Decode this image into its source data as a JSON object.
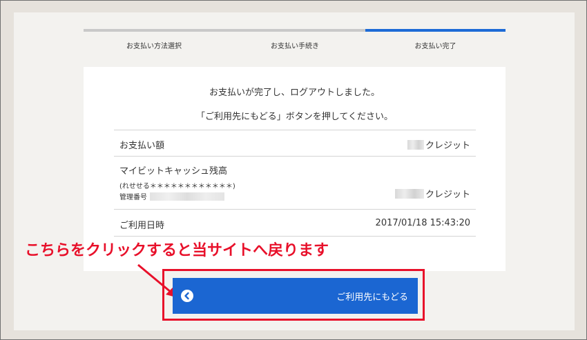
{
  "steps": [
    {
      "label": "お支払い方法選択",
      "active": false
    },
    {
      "label": "お支払い手続き",
      "active": false
    },
    {
      "label": "お支払い完了",
      "active": true
    }
  ],
  "message": {
    "line1": "お支払いが完了し、ログアウトしました。",
    "line2": "「ご利用先にもどる」ボタンを押してください。"
  },
  "payment": {
    "amount_label": "お支払い額",
    "amount_unit": "クレジット",
    "balance_label": "マイビットキャッシュ残高",
    "balance_sub": "(れせせる＊＊＊＊＊＊＊＊＊＊＊＊)",
    "management_label": "管理番号",
    "balance_unit": "クレジット",
    "date_label": "ご利用日時",
    "date_value": "2017/01/18 15:43:20"
  },
  "annotation": {
    "text": "こちらをクリックすると当サイトへ戻ります"
  },
  "return_button": {
    "label": "ご利用先にもどる"
  },
  "colors": {
    "accent": "#1b66d2",
    "annotation": "#e8102a"
  }
}
